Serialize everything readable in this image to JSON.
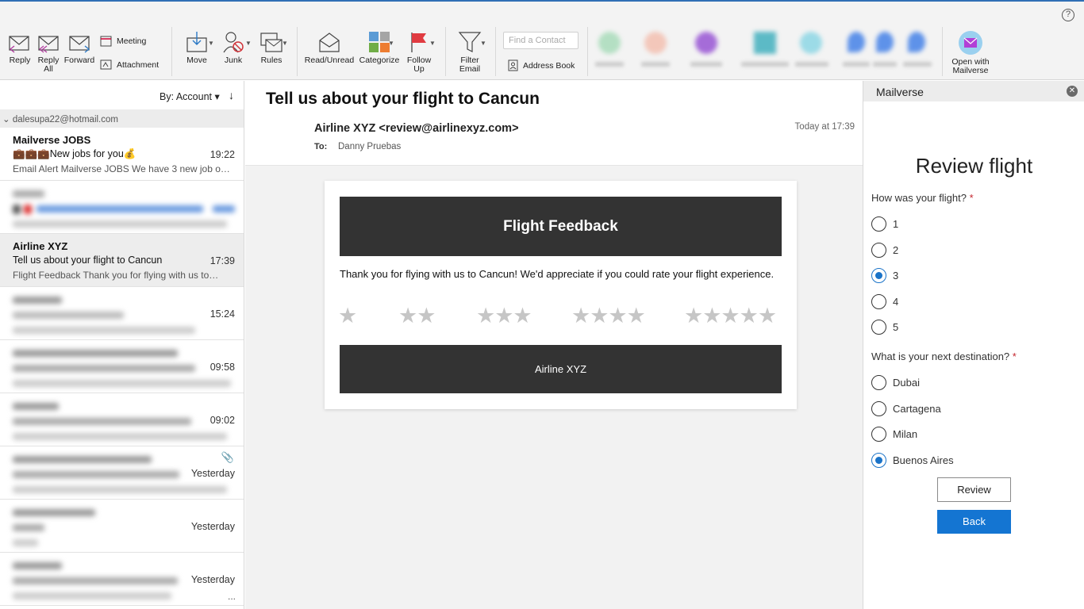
{
  "ribbon": {
    "reply": "Reply",
    "reply_all": "Reply All",
    "forward": "Forward",
    "meeting": "Meeting",
    "attachment": "Attachment",
    "move": "Move",
    "junk": "Junk",
    "rules": "Rules",
    "read_unread": "Read/Unread",
    "categorize": "Categorize",
    "follow_up": "Follow Up",
    "filter_email": "Filter Email",
    "find_contact_placeholder": "Find a Contact",
    "address_book": "Address Book",
    "open_with_mailverse": "Open with Mailverse",
    "help": "?"
  },
  "list": {
    "sort_label": "By: Account",
    "account": "dalesupa22@hotmail.com",
    "items": [
      {
        "from": "Mailverse JOBS",
        "subject": "💼💼💼New jobs for you💰",
        "time": "19:22",
        "preview": "Email Alert Mailverse JOBS We have 3 new job o…"
      },
      {
        "from": "Airline XYZ",
        "subject": "Tell us about your flight to Cancun",
        "time": "17:39",
        "preview": "Flight Feedback Thank you for flying with us to…"
      },
      {
        "time": "15:24"
      },
      {
        "time": "09:58"
      },
      {
        "time": "09:02"
      },
      {
        "time": "Yesterday"
      },
      {
        "time": "Yesterday"
      },
      {
        "time": "Yesterday",
        "more": "..."
      }
    ]
  },
  "message": {
    "subject": "Tell us about your flight to Cancun",
    "sender": "Airline XYZ <review@airlinexyz.com>",
    "date": "Today at 17:39",
    "to_label": "To:",
    "to": "Danny Pruebas",
    "banner": "Flight Feedback",
    "body": "Thank you for flying with us to Cancun! We'd appreciate if you could rate your flight experience.",
    "stars": [
      "★",
      "★★",
      "★★★",
      "★★★★",
      "★★★★★"
    ],
    "footer": "Airline XYZ"
  },
  "addin": {
    "title": "Mailverse",
    "heading": "Review flight",
    "q1": "How was your flight?",
    "q1_options": [
      "1",
      "2",
      "3",
      "4",
      "5"
    ],
    "q1_selected": "3",
    "q2": "What is your next destination?",
    "q2_options": [
      "Dubai",
      "Cartagena",
      "Milan",
      "Buenos Aires"
    ],
    "q2_selected": "Buenos Aires",
    "required_mark": "*",
    "review_button": "Review",
    "back_button": "Back"
  },
  "colors": {
    "accent": "#1475d2",
    "banner": "#333333",
    "required": "#c4262e"
  }
}
